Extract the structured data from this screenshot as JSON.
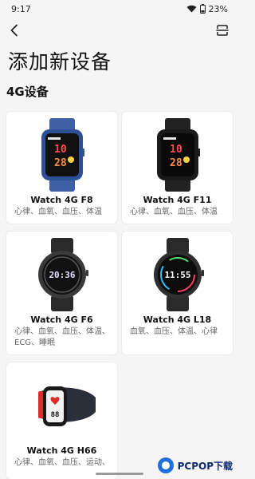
{
  "status_bar": {
    "time": "9:17",
    "battery": "23%"
  },
  "header": {
    "title": "添加新设备",
    "section": "4G设备"
  },
  "devices": [
    {
      "name": "Watch 4G F8",
      "features": "心律、血氧、血压、体温"
    },
    {
      "name": "Watch 4G F11",
      "features": "心律、血氧、血压、体温"
    },
    {
      "name": "Watch 4G F6",
      "features": "心律、血氧、血压、体温、ECG、睡眠"
    },
    {
      "name": "Watch 4G L18",
      "features": "血氧、血压、体温、心律"
    },
    {
      "name": "Watch 4G H66",
      "features": "心律、血氧、血压、运动、"
    }
  ],
  "watch_faces": {
    "f8": {
      "hour": "10",
      "minute": "28"
    },
    "f11": {
      "hour": "10",
      "minute": "28"
    },
    "f6": {
      "time": "20:36"
    },
    "l18": {
      "time": "11:55"
    },
    "h66": {
      "reading": "88"
    }
  },
  "watermark": {
    "text": "PCPOP下载"
  },
  "colors": {
    "background": "#f5f5f5",
    "card": "#ffffff",
    "accent_blue": "#4a6fb5"
  }
}
